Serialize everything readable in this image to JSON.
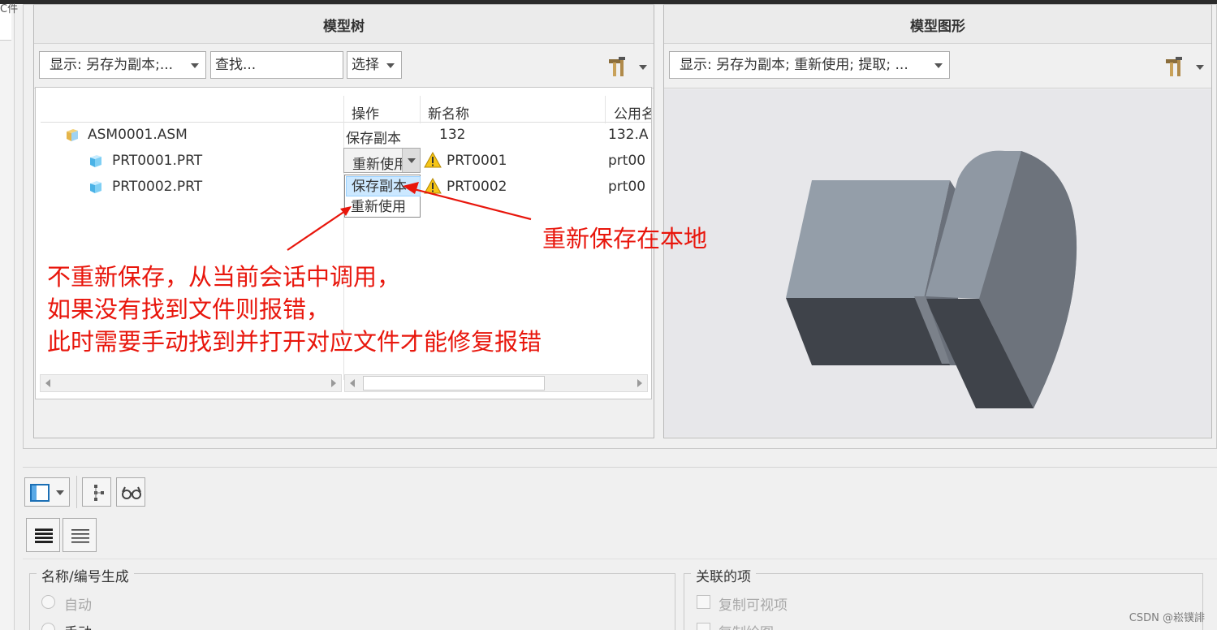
{
  "window": {
    "left_strip_text": "C件"
  },
  "model_tree": {
    "title": "模型树",
    "display_combo": "显示: 另存为副本;...",
    "search_placeholder": "查找...",
    "select_button": "选择",
    "tools_icon": "hammer-wrench-icon",
    "columns": [
      "操作",
      "新名称",
      "公用名"
    ],
    "rows": [
      {
        "name": "ASM0001.ASM",
        "icon": "assembly-icon",
        "operation": "保存副本",
        "new_name": "132",
        "common": "132.A",
        "warning": false
      },
      {
        "name": "PRT0001.PRT",
        "icon": "part-icon",
        "operation": "重新使用",
        "new_name": "PRT0001",
        "common": "prt00",
        "warning": true
      },
      {
        "name": "PRT0002.PRT",
        "icon": "part-icon",
        "operation": "保存副本",
        "new_name": "PRT0002",
        "common": "prt00",
        "warning": true
      }
    ],
    "dropdown_options": [
      "保存副本",
      "重新使用"
    ]
  },
  "model_graphic": {
    "title": "模型图形",
    "display_combo": "显示: 另存为副本; 重新使用; 提取; ...",
    "tools_icon": "hammer-wrench-icon"
  },
  "annotations": {
    "right_note": "重新保存在本地",
    "left_note_lines": [
      "不重新保存，从当前会话中调用，",
      "如果没有找到文件则报错，",
      "此时需要手动找到并打开对应文件才能修复报错"
    ],
    "color": "#e8160c"
  },
  "bottom_toolbar": {
    "buttons": [
      "layout-panel-icon",
      "tree-structure-icon",
      "glasses-icon",
      "list-dense-icon",
      "list-lines-icon"
    ]
  },
  "name_generation": {
    "title": "名称/编号生成",
    "options": [
      "自动",
      "手动"
    ]
  },
  "related_items": {
    "title": "关联的项",
    "options": [
      "复制可视项",
      "复制绘图"
    ]
  },
  "watermark": "CSDN @崧镤誹"
}
